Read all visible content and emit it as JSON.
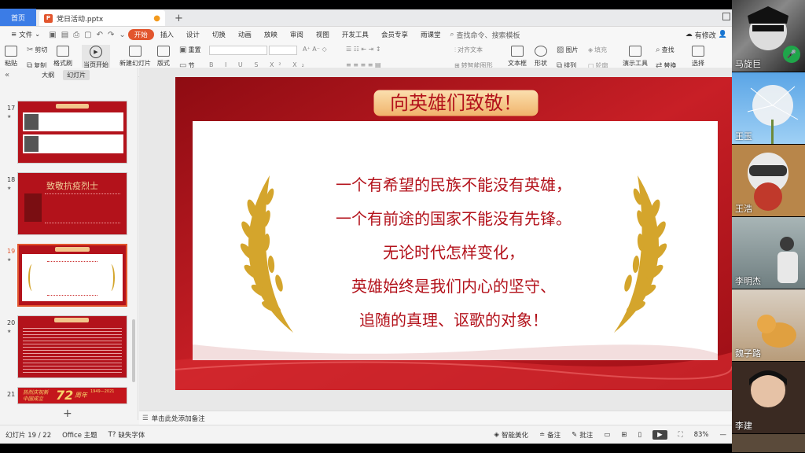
{
  "title_bar": {
    "home_tab": "首页",
    "doc_tab": "党日活动.pptx",
    "file_icon": "P"
  },
  "menu": {
    "file": "文件",
    "tabs": [
      "开始",
      "插入",
      "设计",
      "切换",
      "动画",
      "放映",
      "审阅",
      "视图",
      "开发工具",
      "会员专享",
      "雨课堂"
    ],
    "active": "开始",
    "search": "查找命令、搜索模板",
    "right": "有修改"
  },
  "ribbon": {
    "cut": "剪切",
    "paste": "粘贴",
    "copy": "复制",
    "format_painter": "格式刷",
    "start_here": "当页开始",
    "new_slide": "新建幻灯片",
    "layout": "版式",
    "section": "节",
    "reset": "重置",
    "align_text": "对齐文本",
    "smart_graphic": "转智能图形",
    "textbox": "文本框",
    "shape": "形状",
    "arrange": "排列",
    "picture": "图片",
    "fill": "填充",
    "outline": "轮廓",
    "presentation_tools": "演示工具",
    "find": "查找",
    "replace": "替换",
    "select": "选择"
  },
  "left_panel": {
    "tab_outline": "大纲",
    "tab_slides": "幻灯片",
    "slide_numbers": [
      "17",
      "18",
      "19",
      "20",
      "21"
    ],
    "selected": "19",
    "thumb18_title": "致敬抗疫烈士",
    "thumb21_text": "热烈庆祝新中国成立",
    "thumb21_num": "72",
    "thumb21_suffix": "周年",
    "thumb21_years": "1949—2021"
  },
  "slide": {
    "title": "向英雄们致敬！",
    "lines": [
      "一个有希望的民族不能没有英雄，",
      "一个有前途的国家不能没有先锋。",
      "无论时代怎样变化，",
      "英雄始终是我们内心的坚守、",
      "追随的真理、讴歌的对象！"
    ]
  },
  "notes_placeholder": "单击此处添加备注",
  "status": {
    "slide_counter": "幻灯片 19 / 22",
    "theme": "Office 主题",
    "missing_font": "缺失字体",
    "beautify": "智能美化",
    "notes": "备注",
    "comments": "批注",
    "zoom": "83%"
  },
  "participants": [
    "马旋巨",
    "王玉",
    "王浩",
    "李明杰",
    "魏子路",
    "李建"
  ],
  "colors": {
    "accent": "#e2552d",
    "slide_red": "#b3121b",
    "home_tab": "#3b7ce6",
    "gold": "#d4a52c"
  }
}
